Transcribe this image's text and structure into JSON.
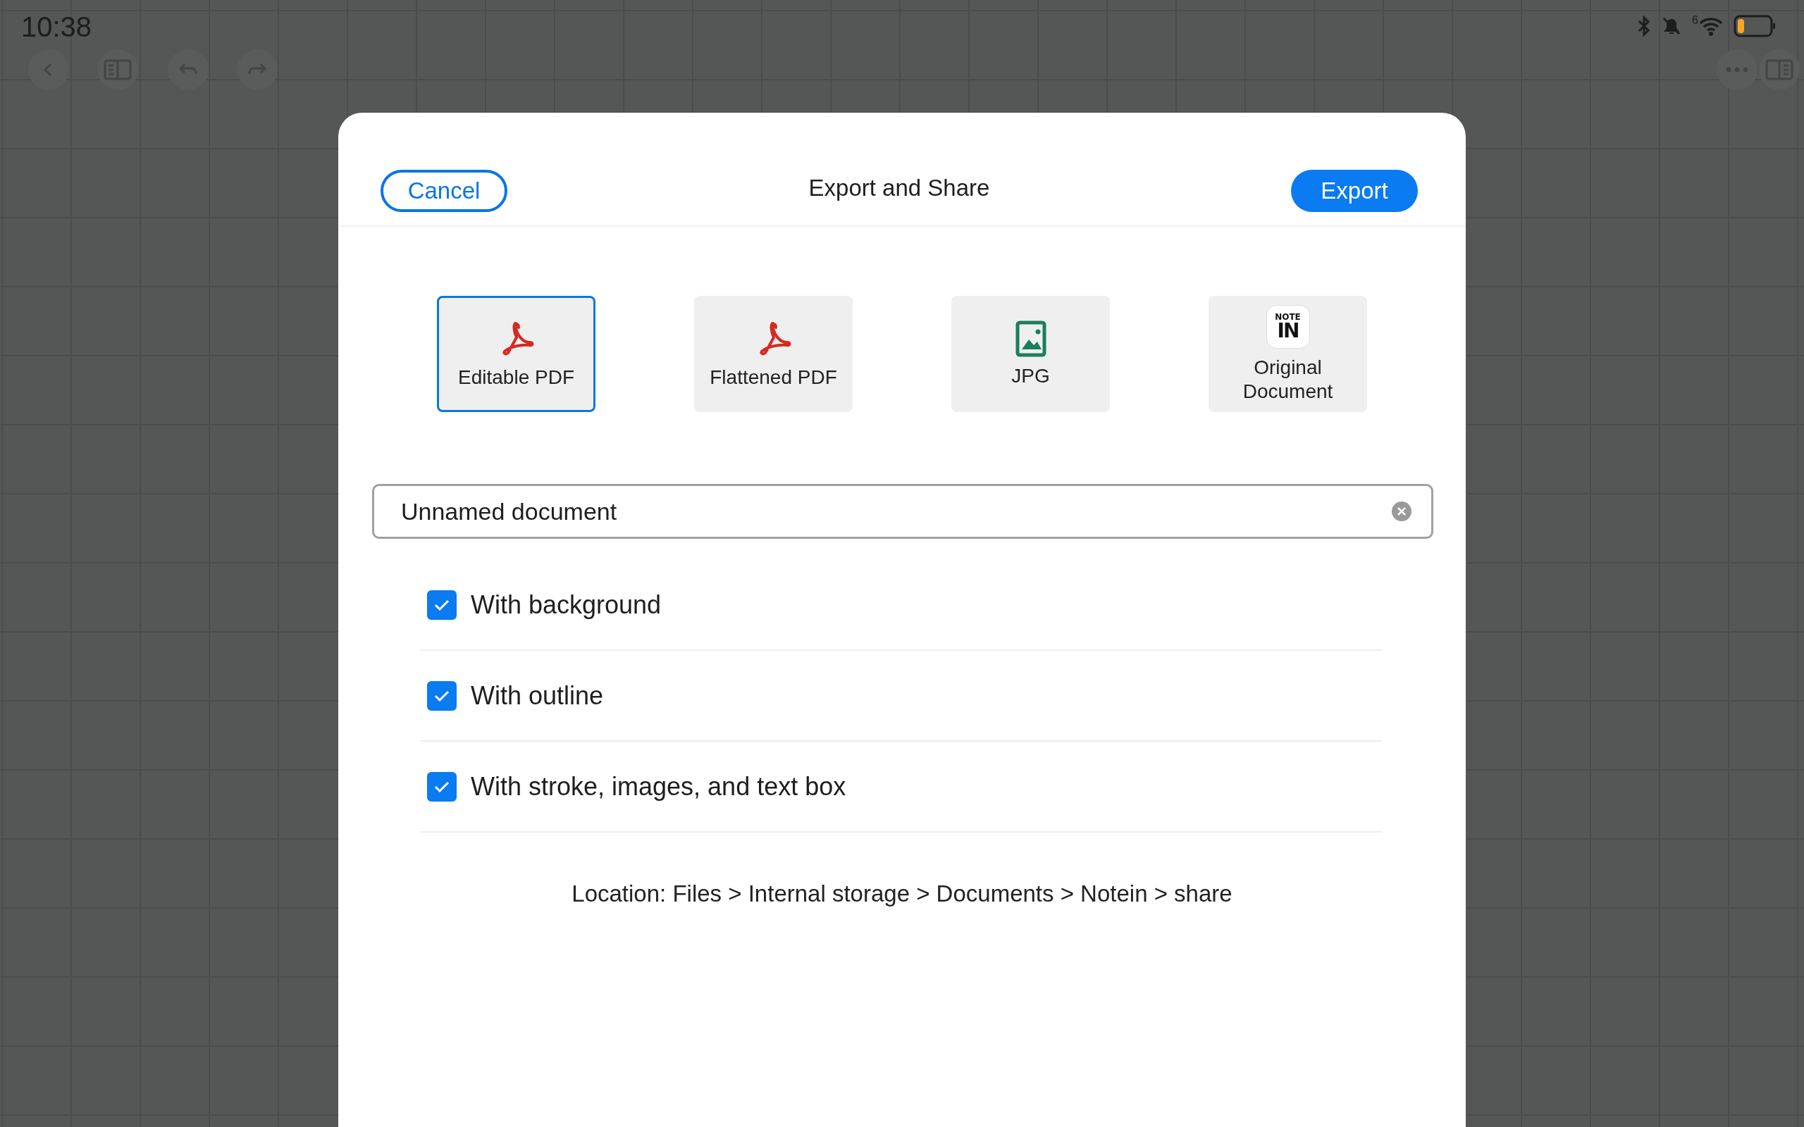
{
  "status_bar": {
    "time": "10:38",
    "notification_badge": "6"
  },
  "dialog": {
    "cancel": "Cancel",
    "title": "Export and Share",
    "export": "Export",
    "formats": [
      {
        "kind": "pdf",
        "label": "Editable PDF",
        "selected": true
      },
      {
        "kind": "pdf",
        "label": "Flattened PDF",
        "selected": false
      },
      {
        "kind": "image",
        "label": "JPG",
        "selected": false
      },
      {
        "kind": "logo",
        "label": "Original Document",
        "logo_top": "NOTE",
        "logo_bottom": "IN",
        "selected": false
      }
    ],
    "filename": {
      "value": "Unnamed document"
    },
    "options": [
      {
        "label": "With background",
        "checked": true
      },
      {
        "label": "With outline",
        "checked": true
      },
      {
        "label": "With stroke, images, and text box",
        "checked": true
      }
    ],
    "location": "Location: Files > Internal storage > Documents > Notein > share"
  }
}
